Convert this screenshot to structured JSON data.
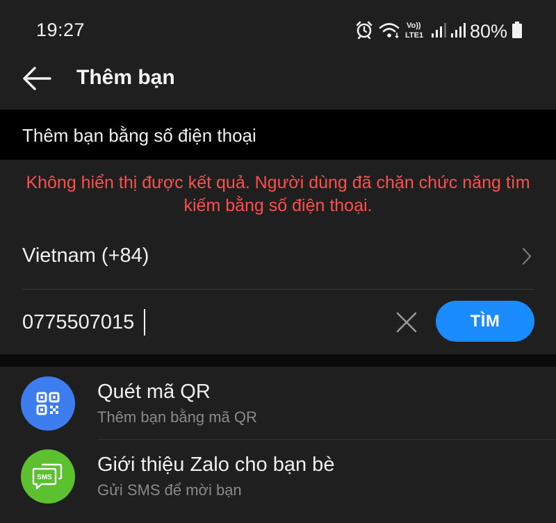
{
  "status_bar": {
    "time": "19:27",
    "battery": "80%",
    "icons": [
      "alarm-icon",
      "wifi-icon",
      "volte-lte-icon",
      "signal-icon",
      "signal-icon",
      "battery-icon"
    ]
  },
  "header": {
    "back_icon": "arrow-left-icon",
    "title": "Thêm bạn"
  },
  "section": {
    "title": "Thêm bạn bằng số điện thoại"
  },
  "error": {
    "line1": "Không hiển thị được kết quả. Người dùng đã chặn chức năng tìm",
    "line2": "kiếm bằng số điện thoại.",
    "color": "#ff4f4f"
  },
  "country": {
    "label": "Vietnam (+84)",
    "chevron_icon": "chevron-right-icon"
  },
  "phone": {
    "value": "0775507015",
    "clear_icon": "close-icon"
  },
  "search_button": {
    "label": "TÌM",
    "color": "#1a8cff"
  },
  "options": [
    {
      "title": "Quét mã QR",
      "subtitle": "Thêm bạn bằng mã QR",
      "icon": "qr-code-icon",
      "color": "#3d7df0"
    },
    {
      "title": "Giới thiệu Zalo cho bạn bè",
      "subtitle": "Gửi SMS để mời bạn",
      "icon": "sms-icon",
      "icon_text": "SMS",
      "color": "#5cc02f"
    }
  ]
}
